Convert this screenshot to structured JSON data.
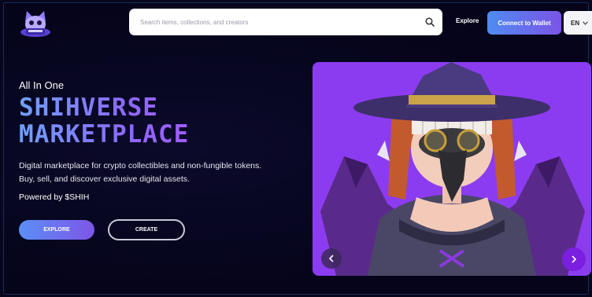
{
  "header": {
    "logo_icon": "shiba-mascot-logo-icon",
    "search": {
      "placeholder": "Search items, collections, and creators",
      "icon": "search-icon"
    },
    "nav": {
      "explore_label": "Explore"
    },
    "connect_label": "Connect to Wallet",
    "language": {
      "selected": "EN",
      "icon": "chevron-down-icon"
    }
  },
  "hero": {
    "kicker": "All In One",
    "title_line1": "SHIHVERSE",
    "title_line2": "MARKETPLACE",
    "description_line1": "Digital marketplace for crypto collectibles and non-fungible tokens.",
    "description_line2": "Buy, sell, and discover exclusive digital assets.",
    "powered_by": "Powered by $SHIH",
    "explore_button": "EXPLORE",
    "create_button": "CREATE",
    "featured_image": "plague-doctor-witch-nft",
    "prev_icon": "chevron-left-icon",
    "next_icon": "chevron-right-icon"
  },
  "colors": {
    "background": "#07061c",
    "accent_blue": "#4f8bf2",
    "accent_purple": "#7a55e6",
    "card_purple": "#8c3cf0"
  }
}
